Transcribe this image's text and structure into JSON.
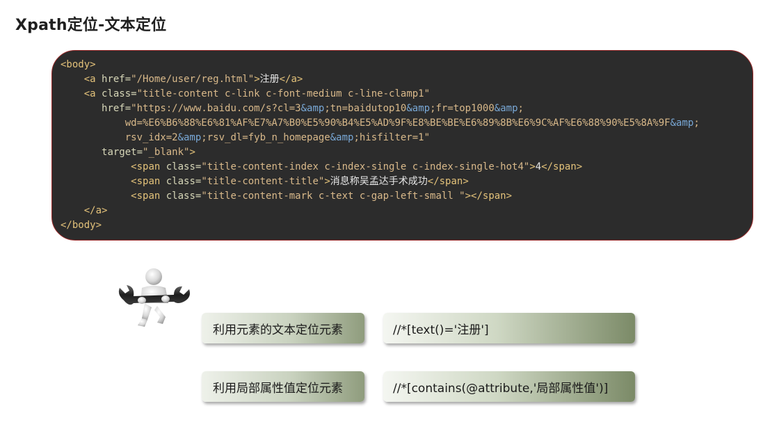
{
  "title": "Xpath定位-文本定位",
  "code_lines": [
    [
      {
        "c": "tag",
        "t": "<body>"
      }
    ],
    [
      {
        "c": "txt",
        "t": "    "
      },
      {
        "c": "tag",
        "t": "<a "
      },
      {
        "c": "attr",
        "t": "href="
      },
      {
        "c": "val",
        "t": "\"/Home/user/reg.html\""
      },
      {
        "c": "tag",
        "t": ">"
      },
      {
        "c": "txt",
        "t": "注册"
      },
      {
        "c": "tag",
        "t": "</a>"
      }
    ],
    [
      {
        "c": "txt",
        "t": "    "
      },
      {
        "c": "tag",
        "t": "<a "
      },
      {
        "c": "attr",
        "t": "class="
      },
      {
        "c": "val",
        "t": "\"title-content c-link c-font-medium c-line-clamp1\""
      }
    ],
    [
      {
        "c": "txt",
        "t": "       "
      },
      {
        "c": "attr",
        "t": "href="
      },
      {
        "c": "val",
        "t": "\"https://www.baidu.com/s?cl=3"
      },
      {
        "c": "ent",
        "t": "&amp"
      },
      {
        "c": "val",
        "t": ";tn=baidutop10"
      },
      {
        "c": "ent",
        "t": "&amp"
      },
      {
        "c": "val",
        "t": ";fr=top1000"
      },
      {
        "c": "ent",
        "t": "&amp"
      },
      {
        "c": "val",
        "t": ";"
      }
    ],
    [
      {
        "c": "txt",
        "t": "           "
      },
      {
        "c": "val",
        "t": "wd=%E6%B6%88%E6%81%AF%E7%A7%B0%E5%90%B4%E5%AD%9F%E8%BE%BE%E6%89%8B%E6%9C%AF%E6%88%90%E5%8A%9F"
      },
      {
        "c": "ent",
        "t": "&amp"
      },
      {
        "c": "val",
        "t": ";"
      }
    ],
    [
      {
        "c": "txt",
        "t": "           "
      },
      {
        "c": "val",
        "t": "rsv_idx=2"
      },
      {
        "c": "ent",
        "t": "&amp"
      },
      {
        "c": "val",
        "t": ";rsv_dl=fyb_n_homepage"
      },
      {
        "c": "ent",
        "t": "&amp"
      },
      {
        "c": "val",
        "t": ";hisfilter=1\""
      }
    ],
    [
      {
        "c": "txt",
        "t": "       "
      },
      {
        "c": "attr",
        "t": "target="
      },
      {
        "c": "val",
        "t": "\"_blank\""
      },
      {
        "c": "tag",
        "t": ">"
      }
    ],
    [
      {
        "c": "txt",
        "t": "            "
      },
      {
        "c": "tag",
        "t": "<span "
      },
      {
        "c": "attr",
        "t": "class="
      },
      {
        "c": "val",
        "t": "\"title-content-index c-index-single c-index-single-hot4\""
      },
      {
        "c": "tag",
        "t": ">"
      },
      {
        "c": "txt",
        "t": "4"
      },
      {
        "c": "tag",
        "t": "</span>"
      }
    ],
    [
      {
        "c": "txt",
        "t": "            "
      },
      {
        "c": "tag",
        "t": "<span "
      },
      {
        "c": "attr",
        "t": "class="
      },
      {
        "c": "val",
        "t": "\"title-content-title\""
      },
      {
        "c": "tag",
        "t": ">"
      },
      {
        "c": "txt",
        "t": "消息称吴孟达手术成功"
      },
      {
        "c": "tag",
        "t": "</span>"
      }
    ],
    [
      {
        "c": "txt",
        "t": "            "
      },
      {
        "c": "tag",
        "t": "<span "
      },
      {
        "c": "attr",
        "t": "class="
      },
      {
        "c": "val",
        "t": "\"title-content-mark c-text c-gap-left-small \""
      },
      {
        "c": "tag",
        "t": "></span>"
      }
    ],
    [
      {
        "c": "txt",
        "t": "    "
      },
      {
        "c": "tag",
        "t": "</a>"
      }
    ],
    [
      {
        "c": "tag",
        "t": "</body>"
      }
    ]
  ],
  "rows": [
    {
      "label": "利用元素的文本定位元素",
      "xpath": "//*[text()='注册']"
    },
    {
      "label": "利用局部属性值定位元素",
      "xpath": "//*[contains(@attribute,'局部属性值')]"
    }
  ],
  "figure_icon": "person-with-wrench-icon"
}
